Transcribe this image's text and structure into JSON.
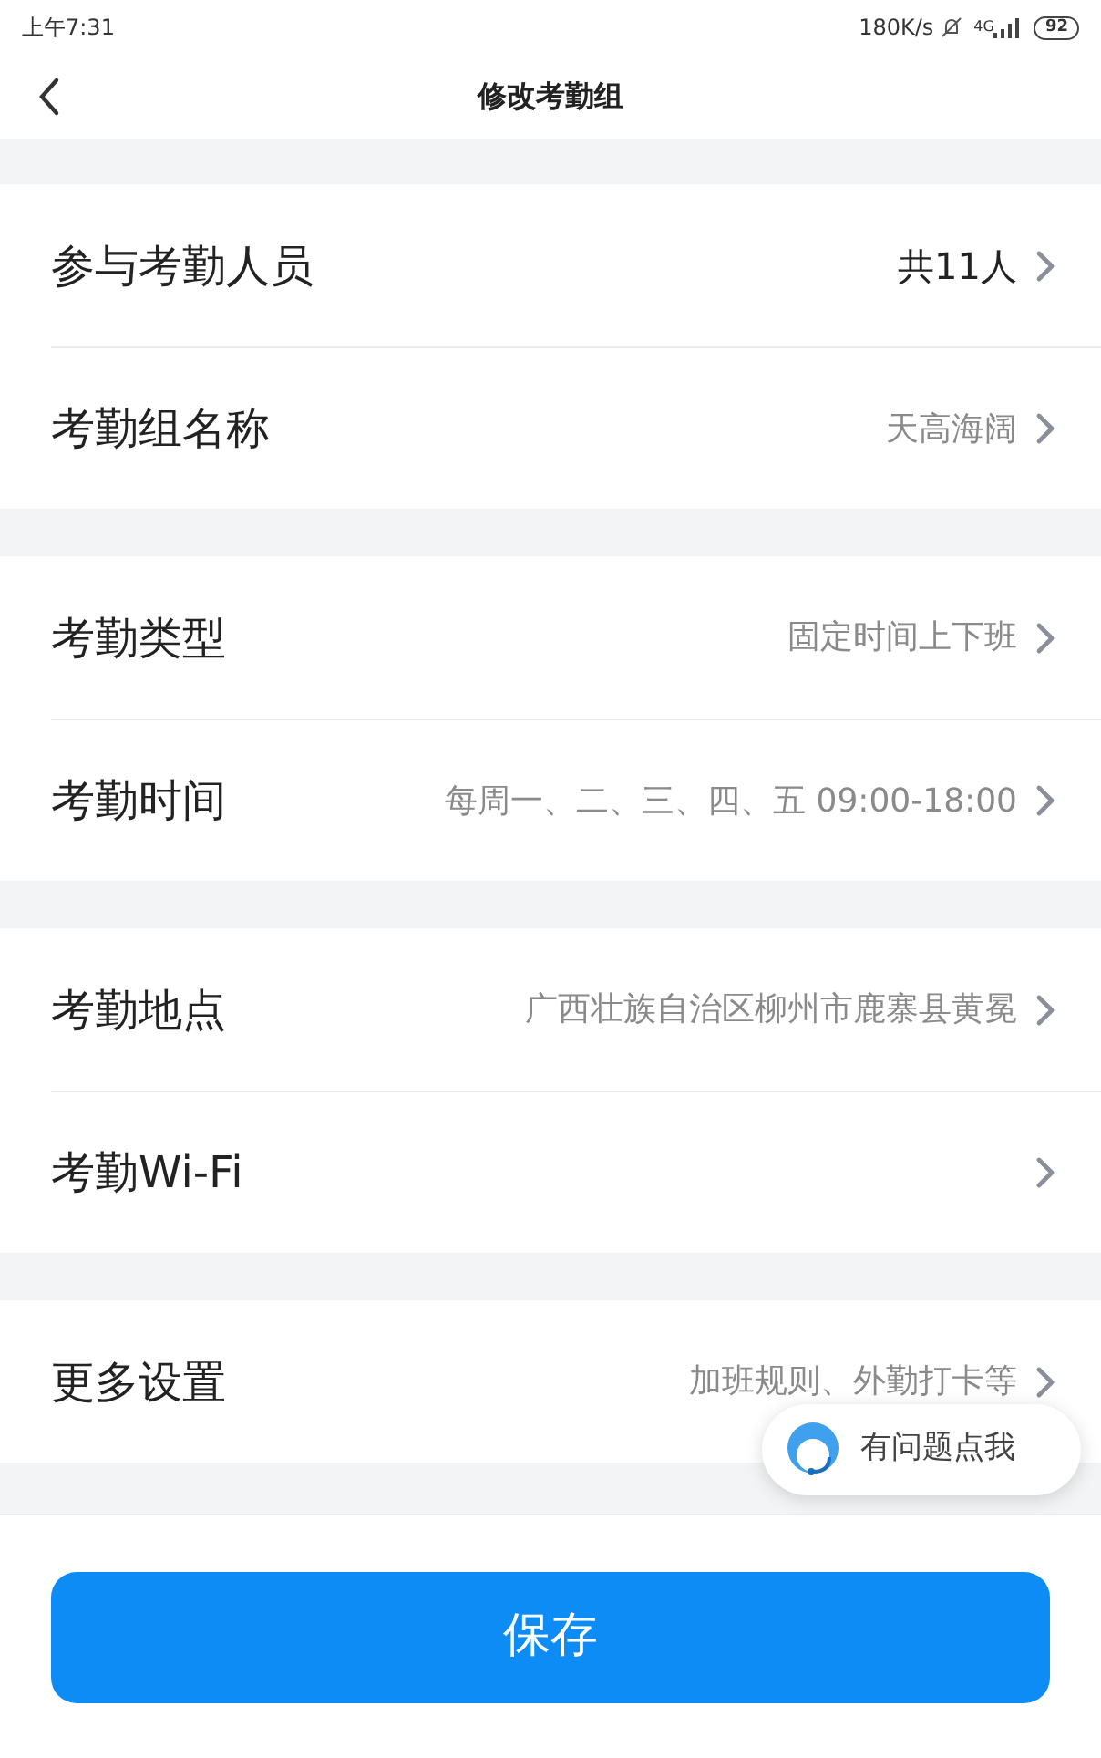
{
  "status_bar": {
    "time": "上午7:31",
    "speed": "180K/s",
    "network": "4G",
    "battery": "92"
  },
  "header": {
    "title": "修改考勤组"
  },
  "sections": [
    {
      "rows": [
        {
          "label": "参与考勤人员",
          "value": "共11人",
          "kind": "count"
        },
        {
          "label": "考勤组名称",
          "value": "天高海阔",
          "kind": "text"
        }
      ]
    },
    {
      "rows": [
        {
          "label": "考勤类型",
          "value": "固定时间上下班",
          "kind": "text"
        },
        {
          "label": "考勤时间",
          "value": "每周一、二、三、四、五 09:00-18:00",
          "kind": "text"
        }
      ]
    },
    {
      "rows": [
        {
          "label": "考勤地点",
          "value": "广西壮族自治区柳州市鹿寨县黄冕",
          "kind": "text"
        },
        {
          "label": "考勤Wi-Fi",
          "kind": "text"
        }
      ]
    },
    {
      "rows": [
        {
          "label": "更多设置",
          "value": "加班规则、外勤打卡等",
          "kind": "text"
        }
      ]
    }
  ],
  "help_bubble": {
    "label": "有问题点我"
  },
  "save_button": {
    "label": "保存"
  }
}
